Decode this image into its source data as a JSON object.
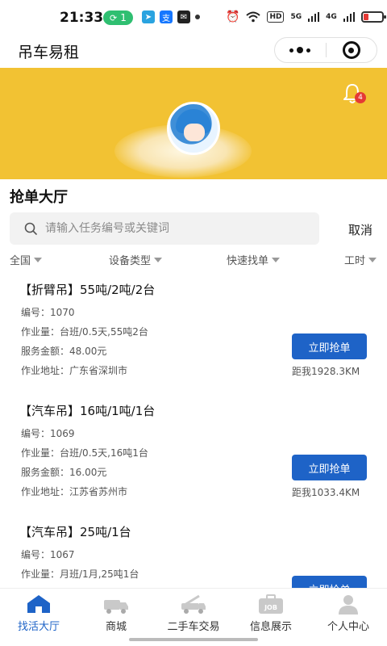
{
  "status_bar": {
    "time": "21:33",
    "pill_text": "1",
    "icons": [
      "wechat-pay-icon",
      "telegram-icon",
      "alipay-icon",
      "mail-icon",
      "dot-icon",
      "alarm-icon",
      "wifi-icon",
      "hd-icon",
      "5g-signal-icon",
      "4g-signal-icon",
      "battery-icon"
    ],
    "hd_label": "HD",
    "signal_5g": "5G",
    "signal_4g": "4G",
    "battery_color": "#e53935"
  },
  "nav": {
    "app_title": "吊车易租"
  },
  "banner": {
    "background": "#f2c233",
    "notification_count": "4"
  },
  "section": {
    "title": "抢单大厅"
  },
  "search": {
    "placeholder": "请输入任务编号或关键词",
    "value": "",
    "cancel_label": "取消"
  },
  "filters": [
    {
      "label": "全国"
    },
    {
      "label": "设备类型"
    },
    {
      "label": "快速找单"
    },
    {
      "label": "工时"
    }
  ],
  "jobs": [
    {
      "title": "【折臂吊】55吨/2吨/2台",
      "id_label": "编号：",
      "id": "1070",
      "workload_label": "作业量：",
      "workload": "台班/0.5天,55吨2台",
      "amount_label": "服务金额：",
      "amount": "48.00元",
      "address_label": "作业地址：",
      "address": "广东省深圳市",
      "button_label": "立即抢单",
      "distance": "距我1928.3KM"
    },
    {
      "title": "【汽车吊】16吨/1吨/1台",
      "id_label": "编号：",
      "id": "1069",
      "workload_label": "作业量：",
      "workload": "台班/0.5天,16吨1台",
      "amount_label": "服务金额：",
      "amount": "16.00元",
      "address_label": "作业地址：",
      "address": "江苏省苏州市",
      "button_label": "立即抢单",
      "distance": "距我1033.4KM"
    },
    {
      "title": "【汽车吊】25吨/1台",
      "id_label": "编号：",
      "id": "1067",
      "workload_label": "作业量：",
      "workload": "月班/1月,25吨1台",
      "button_label": "立即抢单"
    }
  ],
  "tabs": [
    {
      "label": "找活大厅",
      "icon": "home-icon",
      "active": true
    },
    {
      "label": "商城",
      "icon": "truck-icon",
      "active": false
    },
    {
      "label": "二手车交易",
      "icon": "crane-truck-icon",
      "active": false
    },
    {
      "label": "信息展示",
      "icon": "job-briefcase-icon",
      "active": false
    },
    {
      "label": "个人中心",
      "icon": "user-icon",
      "active": false
    }
  ],
  "colors": {
    "accent": "#1e63c7",
    "banner": "#f2c233",
    "badge": "#e53935"
  }
}
